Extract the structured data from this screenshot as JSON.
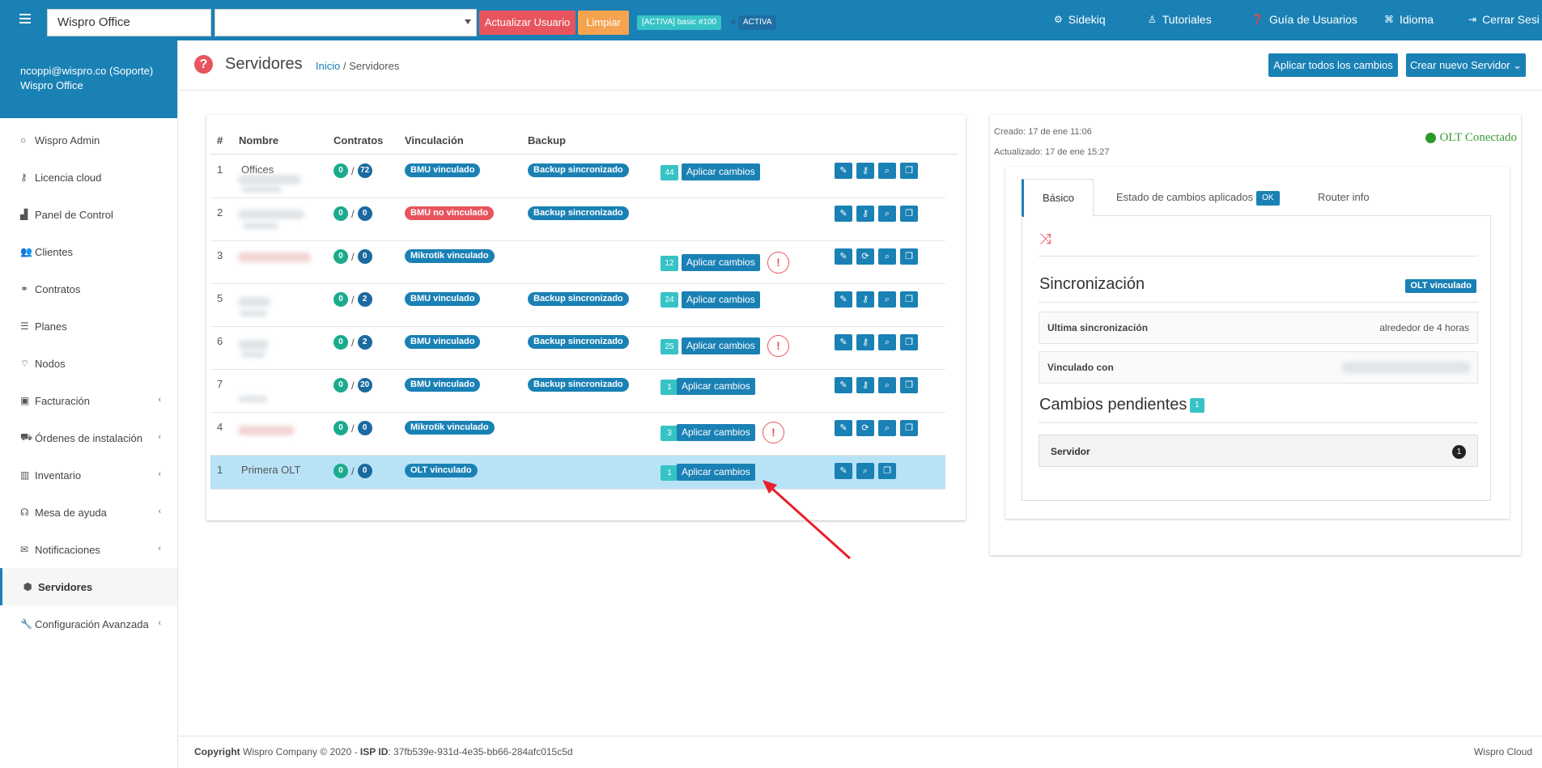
{
  "topbar": {
    "org_value": "Wispro Office",
    "btn_update_user": "Actualizar Usuario",
    "btn_clear": "Limpiar",
    "plan_label": "[ACTIVA] basic #100",
    "status_label": "ACTIVA",
    "nav": [
      {
        "icon": "sitemap-icon",
        "label": "Sidekiq"
      },
      {
        "icon": "person-icon",
        "label": "Tutoriales"
      },
      {
        "icon": "question-circle-icon",
        "label": "Guía de Usuarios"
      },
      {
        "icon": "language-icon",
        "label": "Idioma"
      },
      {
        "icon": "sign-out-icon",
        "label": "Cerrar Sesi"
      }
    ]
  },
  "sidebar": {
    "user_email": "ncoppi@wispro.co (Soporte)",
    "user_org": "Wispro Office",
    "items": [
      {
        "label": "Wispro Admin",
        "icon": "circle-icon"
      },
      {
        "label": "Licencia cloud",
        "icon": "key-icon"
      },
      {
        "label": "Panel de Control",
        "icon": "chart-icon"
      },
      {
        "label": "Clientes",
        "icon": "users-icon"
      },
      {
        "label": "Contratos",
        "icon": "handshake-icon"
      },
      {
        "label": "Planes",
        "icon": "list-icon"
      },
      {
        "label": "Nodos",
        "icon": "wifi-icon"
      },
      {
        "label": "Facturación",
        "icon": "money-icon"
      },
      {
        "label": "Órdenes de instalación",
        "icon": "truck-icon"
      },
      {
        "label": "Inventario",
        "icon": "barcode-icon"
      },
      {
        "label": "Mesa de ayuda",
        "icon": "headset-icon"
      },
      {
        "label": "Notificaciones",
        "icon": "envelope-icon"
      },
      {
        "label": "Servidores",
        "icon": "cube-icon"
      },
      {
        "label": "Configuración Avanzada",
        "icon": "wrench-icon"
      }
    ]
  },
  "header": {
    "title": "Servidores",
    "breadcrumb_home": "Inicio",
    "breadcrumb_sep": " / ",
    "breadcrumb_current": "Servidores",
    "btn_apply_all": "Aplicar todos los cambios",
    "btn_create": "Crear nuevo Servidor"
  },
  "table": {
    "headers": [
      "#",
      "Nombre",
      "Contratos",
      "Vinculación",
      "Backup"
    ],
    "apply_label": "Aplicar cambios",
    "rows": [
      {
        "num": "1",
        "name": "Offices",
        "c1": "0",
        "c2": "72",
        "link": "BMU vinculado",
        "link_type": "blue",
        "backup": "Backup sincronizado",
        "pending": "44",
        "warn": false,
        "sync_icon": false
      },
      {
        "num": "2",
        "name": "",
        "c1": "0",
        "c2": "0",
        "link": "BMU no vinculado",
        "link_type": "red",
        "backup": "Backup sincronizado",
        "pending": "",
        "warn": false,
        "sync_icon": false
      },
      {
        "num": "3",
        "name": "",
        "c1": "0",
        "c2": "0",
        "link": "Mikrotik vinculado",
        "link_type": "blue",
        "backup": "",
        "pending": "12",
        "warn": true,
        "sync_icon": true
      },
      {
        "num": "5",
        "name": "",
        "c1": "0",
        "c2": "2",
        "link": "BMU vinculado",
        "link_type": "blue",
        "backup": "Backup sincronizado",
        "pending": "24",
        "warn": false,
        "sync_icon": false
      },
      {
        "num": "6",
        "name": "",
        "c1": "0",
        "c2": "2",
        "link": "BMU vinculado",
        "link_type": "blue",
        "backup": "Backup sincronizado",
        "pending": "25",
        "warn": true,
        "sync_icon": false
      },
      {
        "num": "7",
        "name": "",
        "c1": "0",
        "c2": "20",
        "link": "BMU vinculado",
        "link_type": "blue",
        "backup": "Backup sincronizado",
        "pending": "1",
        "warn": false,
        "sync_icon": false
      },
      {
        "num": "4",
        "name": "",
        "c1": "0",
        "c2": "0",
        "link": "Mikrotik vinculado",
        "link_type": "blue",
        "backup": "",
        "pending": "3",
        "warn": true,
        "sync_icon": true
      },
      {
        "num": "1",
        "name": "Primera OLT",
        "c1": "0",
        "c2": "0",
        "link": "OLT vinculado",
        "link_type": "blue",
        "backup": "",
        "pending": "1",
        "warn": false,
        "sync_icon": false
      }
    ]
  },
  "detail": {
    "created": "Creado: 17 de ene 11:06",
    "updated": "Actualizado: 17 de ene 15:27",
    "olt_status": "OLT Conectado",
    "tabs": {
      "basic": "Básico",
      "changes": "Estado de cambios aplicados",
      "changes_badge": "OK",
      "router": "Router info"
    },
    "sync_title": "Sincronización",
    "sync_badge": "OLT vinculado",
    "last_sync_label": "Ultima sincronización",
    "last_sync_value": "alrededor de 4 horas",
    "linked_label": "Vinculado con",
    "pending_title": "Cambios pendientes",
    "pending_count": "1",
    "server_label": "Servidor",
    "server_count": "1"
  },
  "footer": {
    "copyright_label": "Copyright",
    "company": " Wispro Company © 2020 - ",
    "isp_label": "ISP ID",
    "isp_value": ": 37fb539e-931d-4e35-bb66-284afc015c5d",
    "right": "Wispro Cloud"
  },
  "colors": {
    "primary": "#1a81b5",
    "danger": "#e8545d",
    "warning": "#f5a34f",
    "info": "#36c3c6",
    "success": "#1bab8c"
  }
}
